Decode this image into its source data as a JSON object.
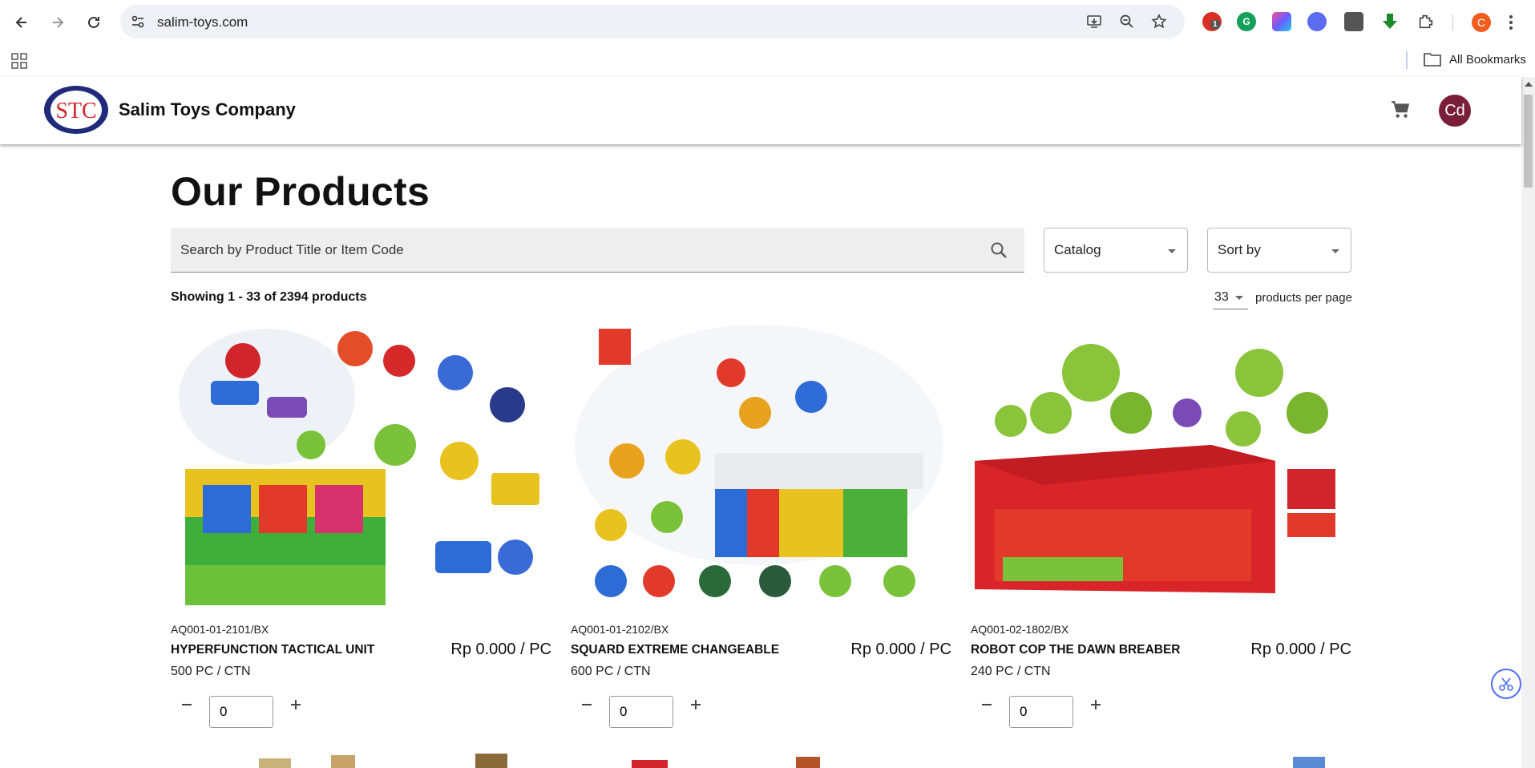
{
  "browser": {
    "url": "salim-toys.com",
    "extension_badge": "1",
    "profile_initial": "C",
    "all_bookmarks_label": "All Bookmarks"
  },
  "header": {
    "brand": "Salim Toys Company",
    "logo_text": "STC",
    "avatar_initials": "Cd"
  },
  "main": {
    "title": "Our Products",
    "search_placeholder": "Search by Product Title or Item Code",
    "catalog_label": "Catalog",
    "sort_label": "Sort by",
    "showing": "Showing 1 - 33 of 2394 products",
    "per_page_value": "33",
    "per_page_label": "products per page"
  },
  "products": [
    {
      "code": "AQ001-01-2101/BX",
      "title": "HYPERFUNCTION TACTICAL UNIT",
      "price": "Rp 0.000 / PC",
      "pack": "500 PC / CTN",
      "qty": "0"
    },
    {
      "code": "AQ001-01-2102/BX",
      "title": "SQUARD EXTREME CHANGEABLE",
      "price": "Rp 0.000 / PC",
      "pack": "600 PC / CTN",
      "qty": "0"
    },
    {
      "code": "AQ001-02-1802/BX",
      "title": "ROBOT COP THE DAWN BREABER",
      "price": "Rp 0.000 / PC",
      "pack": "240 PC / CTN",
      "qty": "0"
    }
  ],
  "colors": {
    "accent_avatar": "#7a1f3a",
    "logo_blue": "#1f2a7a",
    "logo_red": "#d0262b"
  }
}
